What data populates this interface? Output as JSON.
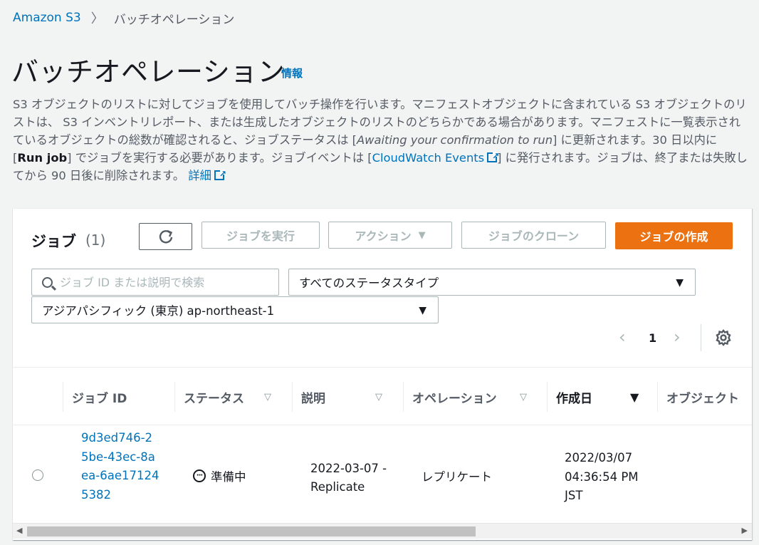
{
  "breadcrumb": {
    "root": "Amazon S3",
    "current": "バッチオペレーション"
  },
  "header": {
    "title": "バッチオペレーション",
    "info": "情報"
  },
  "description": {
    "p1": "S3 オブジェクトのリストに対してジョブを使用してバッチ操作を行います。マニフェストオブジェクトに含まれている S3 オブジェクトのリストは、 S3 インベントリレポート、または生成したオブジェクトのリストのどちらかである場合があります。マニフェストに一覧表示されているオブジェクトの総数が確認されると、ジョブステータスは [",
    "awaiting": "Awaiting your confirmation to run",
    "p2": "] に更新されます。30 日以内に [",
    "run_job": "Run job",
    "p3": "] でジョブを実行する必要があります。ジョブイベントは [",
    "cloudwatch": "CloudWatch Events",
    "p4": "] に発行されます。ジョブは、終了または失敗してから 90 日後に削除されます。",
    "details": "詳細"
  },
  "jobs": {
    "title": "ジョブ",
    "count": "(1)",
    "run_label": "ジョブを実行",
    "action_label": "アクション",
    "clone_label": "ジョブのクローン",
    "create_label": "ジョブの作成",
    "search_placeholder": "ジョブ ID または説明で検索",
    "status_filter": "すべてのステータスタイプ",
    "region_filter": "アジアパシフィック (東京) ap-northeast-1",
    "page": "1"
  },
  "table": {
    "headers": [
      "ジョブ ID",
      "ステータス",
      "説明",
      "オペレーション",
      "作成日",
      "オブジェクト"
    ],
    "rows": [
      {
        "job_id": "9d3ed746-25be-43ec-8aea-6ae171245382",
        "status": "準備中",
        "description": "2022-03-07 - Replicate",
        "operation": "レプリケート",
        "created": "2022/03/07 04:36:54 PM JST"
      }
    ]
  },
  "colors": {
    "accent": "#ec7211",
    "link": "#0073bb",
    "bg": "#f2f3f3"
  }
}
